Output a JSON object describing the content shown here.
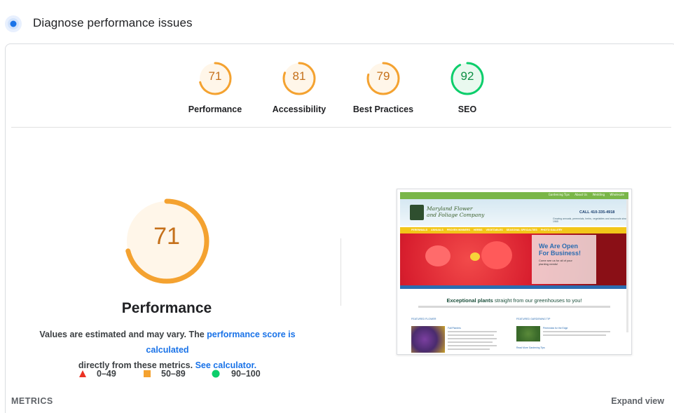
{
  "header": {
    "title": "Diagnose performance issues",
    "icon": "diagnose-icon"
  },
  "scores": [
    {
      "label": "Performance",
      "value": "71",
      "fraction": 0.71,
      "color": "#f4a230",
      "text_color": "#c5701a"
    },
    {
      "label": "Accessibility",
      "value": "81",
      "fraction": 0.81,
      "color": "#f4a230",
      "text_color": "#c5701a"
    },
    {
      "label": "Best Practices",
      "value": "79",
      "fraction": 0.79,
      "color": "#f4a230",
      "text_color": "#c5701a"
    },
    {
      "label": "SEO",
      "value": "92",
      "fraction": 0.92,
      "color": "#0cce6b",
      "text_color": "#0d8f43"
    }
  ],
  "performance": {
    "value": "71",
    "fraction": 0.71,
    "title": "Performance",
    "desc_part1": "Values are estimated and may vary. The ",
    "desc_link1": "performance score is calculated",
    "desc_part2": " directly from these metrics. ",
    "desc_link2": "See calculator."
  },
  "legend": [
    {
      "icon": "red-triangle-icon",
      "range": "0–49",
      "color": "#eb3223"
    },
    {
      "icon": "orange-square-icon",
      "range": "50–89",
      "color": "#f4a230"
    },
    {
      "icon": "green-circle-icon",
      "range": "90–100",
      "color": "#0cce6b"
    }
  ],
  "thumbnail": {
    "top_links": [
      "Gardening Tips",
      "About Us",
      "Wedding",
      "Wholesale"
    ],
    "logo_line1": "Maryland Flower",
    "logo_line2": "and Foliage Company",
    "call": "CALL 410-335-4918",
    "subline": "Growing annuals, perennials, herbs, vegetables and seasonals since 1965",
    "nav": [
      "PERENNIALS",
      "ANNUALS",
      "PROVEN WINNERS",
      "HERBS",
      "VEGETABLES",
      "SEASONAL SPECIALTIES",
      "PHOTO GALLERY"
    ],
    "hero_heading_1": "We Are Open",
    "hero_heading_2": "For Business!",
    "hero_sub_1": "Come see us for all of your",
    "hero_sub_2": "planting needs!",
    "excep_bold": "Exceptional plants",
    "excep_rest": " straight from our greenhouses to you!",
    "featured_flower": "FEATURED FLOWER",
    "featured_tip": "FEATURED GARDENING TIP",
    "feature_item_1": "Fall Planters",
    "feature_item_2": "Perennials for the Edge",
    "read_more": "Read More Gardening Tips"
  },
  "footer": {
    "metrics": "METRICS",
    "expand": "Expand view"
  }
}
